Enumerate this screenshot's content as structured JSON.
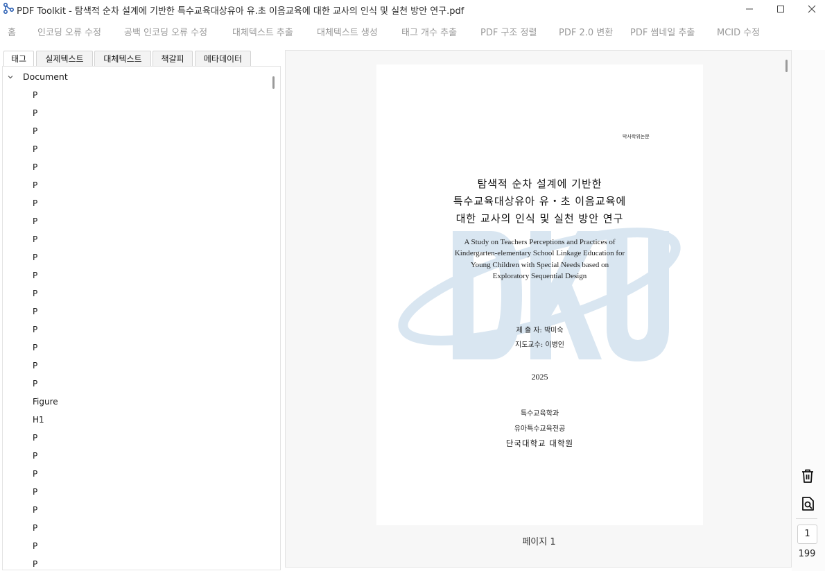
{
  "window": {
    "title": "PDF Toolkit - 탐색적 순차 설계에 기반한 특수교육대상유아 유.초 이음교육에 대한 교사의 인식 및 실천 방안 연구.pdf"
  },
  "menu": [
    "홈",
    "인코딩 오류 수정",
    "공백 인코딩 오류 수정",
    "대체텍스트 추출",
    "대체텍스트 생성",
    "태그 개수 추출",
    "PDF 구조 정렬",
    "PDF 2.0 변환",
    "PDF 썸네일 추출",
    "MCID 수정"
  ],
  "tabs": [
    "태그",
    "실제텍스트",
    "대체텍스트",
    "책갈피",
    "메타데이터"
  ],
  "tree": {
    "root": "Document",
    "items": [
      "P",
      "P",
      "P",
      "P",
      "P",
      "P",
      "P",
      "P",
      "P",
      "P",
      "P",
      "P",
      "P",
      "P",
      "P",
      "P",
      "P",
      "Figure",
      "H1",
      "P",
      "P",
      "P",
      "P",
      "P",
      "P",
      "P",
      "P"
    ]
  },
  "document": {
    "degree_label": "박사학위논문",
    "korean_title": [
      "탐색적 순차 설계에 기반한",
      "특수교육대상유아 유・초 이음교육에",
      "대한 교사의 인식 및 실천 방안 연구"
    ],
    "english_title": [
      "A Study on Teachers Perceptions and Practices of",
      "Kindergarten-elementary School Linkage Education for",
      "Young Children with Special Needs based on",
      "Exploratory Sequential Design"
    ],
    "author": "제 출 자: 박미숙",
    "advisor": "지도교수: 이병인",
    "year": "2025",
    "department": "특수교육학과",
    "major": "유아특수교육전공",
    "university": "단국대학교 대학원",
    "watermark": "DKU"
  },
  "viewer": {
    "page_caption": "페이지 1"
  },
  "pagination": {
    "current": "1",
    "total": "199"
  },
  "colors": {
    "watermark": "#d9e6f1",
    "menu_text": "#9a9a9a",
    "app_icon": "#2b5fb3"
  }
}
